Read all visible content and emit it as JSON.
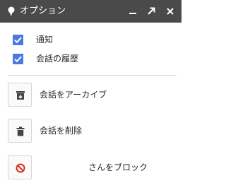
{
  "window": {
    "title": "オプション",
    "title_icon": "chat-bubble-icon",
    "controls": [
      "minimize-icon",
      "popout-icon",
      "close-icon"
    ]
  },
  "settings": {
    "notify": {
      "label": "通知",
      "checked": true
    },
    "history": {
      "label": "会話の履歴",
      "checked": true
    }
  },
  "actions": {
    "archive": {
      "label": "会話をアーカイブ",
      "icon": "archive-icon"
    },
    "delete": {
      "label": "会話を削除",
      "icon": "trash-icon"
    },
    "block": {
      "label": "さんをブロック",
      "icon": "block-icon"
    }
  },
  "colors": {
    "titlebar": "#4a4a4a",
    "checkbox": "#4d78e0",
    "block_red": "#d93025"
  }
}
